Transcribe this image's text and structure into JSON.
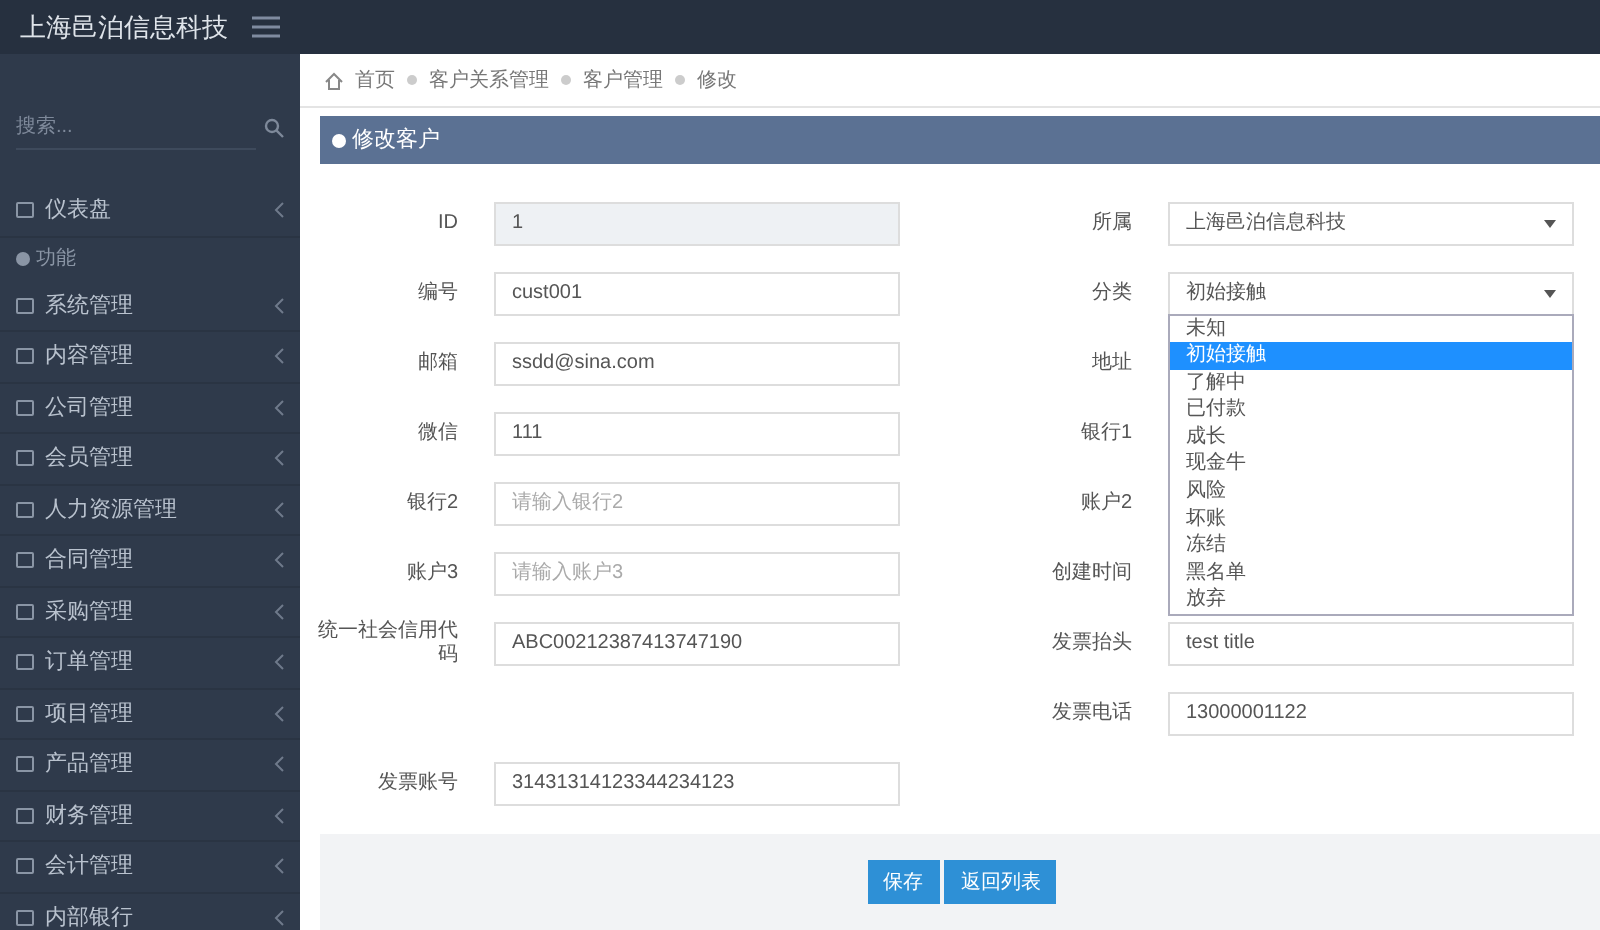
{
  "brand": "上海邑泊信息科技",
  "sidebar": {
    "search_placeholder": "搜索...",
    "items": [
      {
        "kind": "link",
        "label": "仪表盘"
      },
      {
        "kind": "header",
        "label": "功能"
      },
      {
        "kind": "link",
        "label": "系统管理"
      },
      {
        "kind": "link",
        "label": "内容管理"
      },
      {
        "kind": "link",
        "label": "公司管理"
      },
      {
        "kind": "link",
        "label": "会员管理"
      },
      {
        "kind": "link",
        "label": "人力资源管理"
      },
      {
        "kind": "link",
        "label": "合同管理"
      },
      {
        "kind": "link",
        "label": "采购管理"
      },
      {
        "kind": "link",
        "label": "订单管理"
      },
      {
        "kind": "link",
        "label": "项目管理"
      },
      {
        "kind": "link",
        "label": "产品管理"
      },
      {
        "kind": "link",
        "label": "财务管理"
      },
      {
        "kind": "link",
        "label": "会计管理"
      },
      {
        "kind": "link",
        "label": "内部银行"
      }
    ]
  },
  "breadcrumb": [
    "首页",
    "客户关系管理",
    "客户管理",
    "修改"
  ],
  "panel_title": "修改客户",
  "rows": [
    {
      "left": {
        "label": "ID",
        "kind": "readonly",
        "value": "1"
      },
      "right": {
        "label": "所属",
        "kind": "select",
        "value": "上海邑泊信息科技"
      }
    },
    {
      "left": {
        "label": "编号",
        "kind": "text",
        "value": "cust001"
      },
      "right": {
        "label": "分类",
        "kind": "select",
        "value": "初始接触",
        "open": true,
        "options": [
          {
            "label": "未知",
            "selected": false
          },
          {
            "label": "初始接触",
            "selected": true
          },
          {
            "label": "了解中",
            "selected": false
          },
          {
            "label": "已付款",
            "selected": false
          },
          {
            "label": "成长",
            "selected": false
          },
          {
            "label": "现金牛",
            "selected": false
          },
          {
            "label": "风险",
            "selected": false
          },
          {
            "label": "坏账",
            "selected": false
          },
          {
            "label": "冻结",
            "selected": false
          },
          {
            "label": "黑名单",
            "selected": false
          },
          {
            "label": "放弃",
            "selected": false
          }
        ]
      }
    },
    {
      "left": {
        "label": "邮箱",
        "kind": "text",
        "value": "ssdd@sina.com"
      },
      "right": {
        "label": "地址",
        "kind": "text"
      }
    },
    {
      "left": {
        "label": "微信",
        "kind": "text",
        "value": "111"
      },
      "right": {
        "label": "银行1",
        "kind": "text"
      }
    },
    {
      "left": {
        "label": "银行2",
        "kind": "text",
        "placeholder": "请输入银行2"
      },
      "right": {
        "label": "账户2",
        "kind": "text"
      }
    },
    {
      "left": {
        "label": "账户3",
        "kind": "text",
        "placeholder": "请输入账户3"
      },
      "right": {
        "label": "创建时间",
        "kind": "text"
      }
    },
    {
      "left": {
        "label": "统一社会信用代码",
        "kind": "text",
        "value": "ABC00212387413747190"
      },
      "right": {
        "label": "发票抬头",
        "kind": "text",
        "value": "test title"
      }
    },
    {
      "right": {
        "label": "发票电话",
        "kind": "text",
        "value": "13000001122"
      }
    },
    {
      "left": {
        "label": "发票账号",
        "kind": "text",
        "value": "31431314123344234123"
      }
    }
  ],
  "buttons": [
    "保存",
    "返回列表"
  ]
}
